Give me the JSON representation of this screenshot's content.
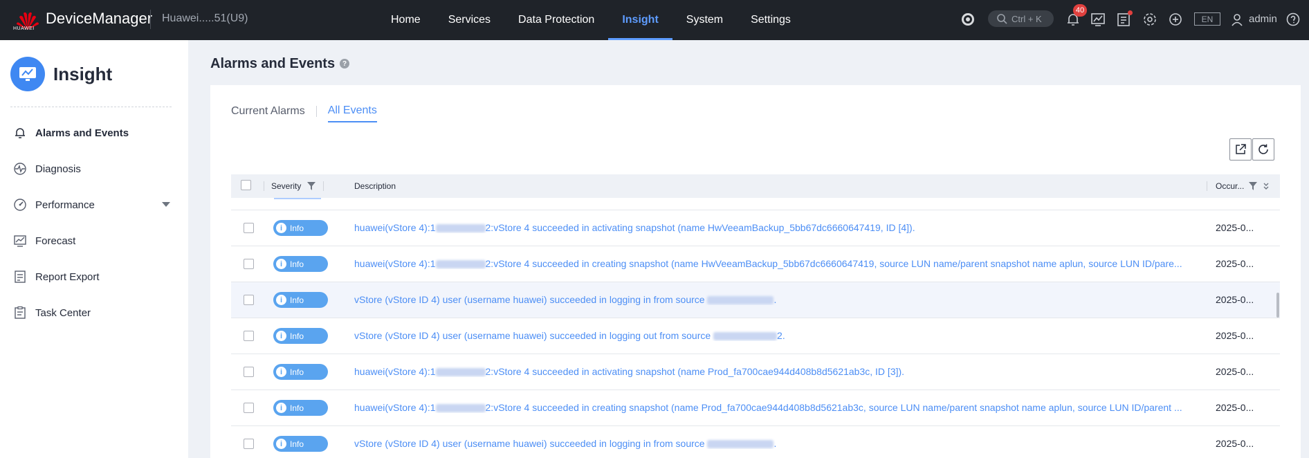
{
  "topbar": {
    "brand": "HUAWEI",
    "app_name": "DeviceManager",
    "device_name": "Huawei.....51(U9)",
    "nav": [
      "Home",
      "Services",
      "Data Protection",
      "Insight",
      "System",
      "Settings"
    ],
    "active_nav": "Insight",
    "search_shortcut": "Ctrl + K",
    "notification_count": "40",
    "language": "EN",
    "user": "admin"
  },
  "sidebar": {
    "title": "Insight",
    "items": [
      {
        "label": "Alarms and Events",
        "icon": "bell-icon"
      },
      {
        "label": "Diagnosis",
        "icon": "pulse-icon"
      },
      {
        "label": "Performance",
        "icon": "gauge-icon"
      },
      {
        "label": "Forecast",
        "icon": "chart-icon"
      },
      {
        "label": "Report Export",
        "icon": "report-icon"
      },
      {
        "label": "Task Center",
        "icon": "clipboard-icon"
      }
    ]
  },
  "main": {
    "title": "Alarms and Events",
    "tabs": [
      "Current Alarms",
      "All Events"
    ],
    "active_tab": "All Events",
    "columns": {
      "severity": "Severity",
      "description": "Description",
      "occurred": "Occur..."
    },
    "rows": [
      {
        "severity": "Info",
        "prefix": "huawei(vStore 4):1",
        "blur_w": 72,
        "suffix": "2:vStore 4 succeeded in activating snapshot (name HwVeeamBackup_5bb67dc6660647419, ID [4]).",
        "occurred": "2025-0..."
      },
      {
        "severity": "Info",
        "prefix": "huawei(vStore 4):1",
        "blur_w": 72,
        "suffix": "2:vStore 4 succeeded in creating snapshot (name HwVeeamBackup_5bb67dc6660647419, source LUN name/parent snapshot name aplun, source LUN ID/pare...",
        "occurred": "2025-0..."
      },
      {
        "severity": "Info",
        "prefix": "vStore (vStore ID 4) user (username huawei) succeeded in logging in from source ",
        "blur_w": 96,
        "suffix": ".",
        "occurred": "2025-0..."
      },
      {
        "severity": "Info",
        "prefix": "vStore (vStore ID 4) user (username huawei) succeeded in logging out from source ",
        "blur_w": 92,
        "suffix": "2.",
        "occurred": "2025-0..."
      },
      {
        "severity": "Info",
        "prefix": "huawei(vStore 4):1",
        "blur_w": 72,
        "suffix": "2:vStore 4 succeeded in activating snapshot (name Prod_fa700cae944d408b8d5621ab3c, ID [3]).",
        "occurred": "2025-0..."
      },
      {
        "severity": "Info",
        "prefix": "huawei(vStore 4):1",
        "blur_w": 72,
        "suffix": "2:vStore 4 succeeded in creating snapshot (name Prod_fa700cae944d408b8d5621ab3c, source LUN name/parent snapshot name aplun, source LUN ID/parent ...",
        "occurred": "2025-0..."
      },
      {
        "severity": "Info",
        "prefix": "vStore (vStore ID 4) user (username huawei) succeeded in logging in from source ",
        "blur_w": 96,
        "suffix": ".",
        "occurred": "2025-0..."
      }
    ],
    "highlighted_row": 2
  },
  "colors": {
    "accent": "#4c8ef5",
    "topbar": "#1f2329",
    "info_pill": "#5aa4ef",
    "badge": "#e0403e"
  }
}
